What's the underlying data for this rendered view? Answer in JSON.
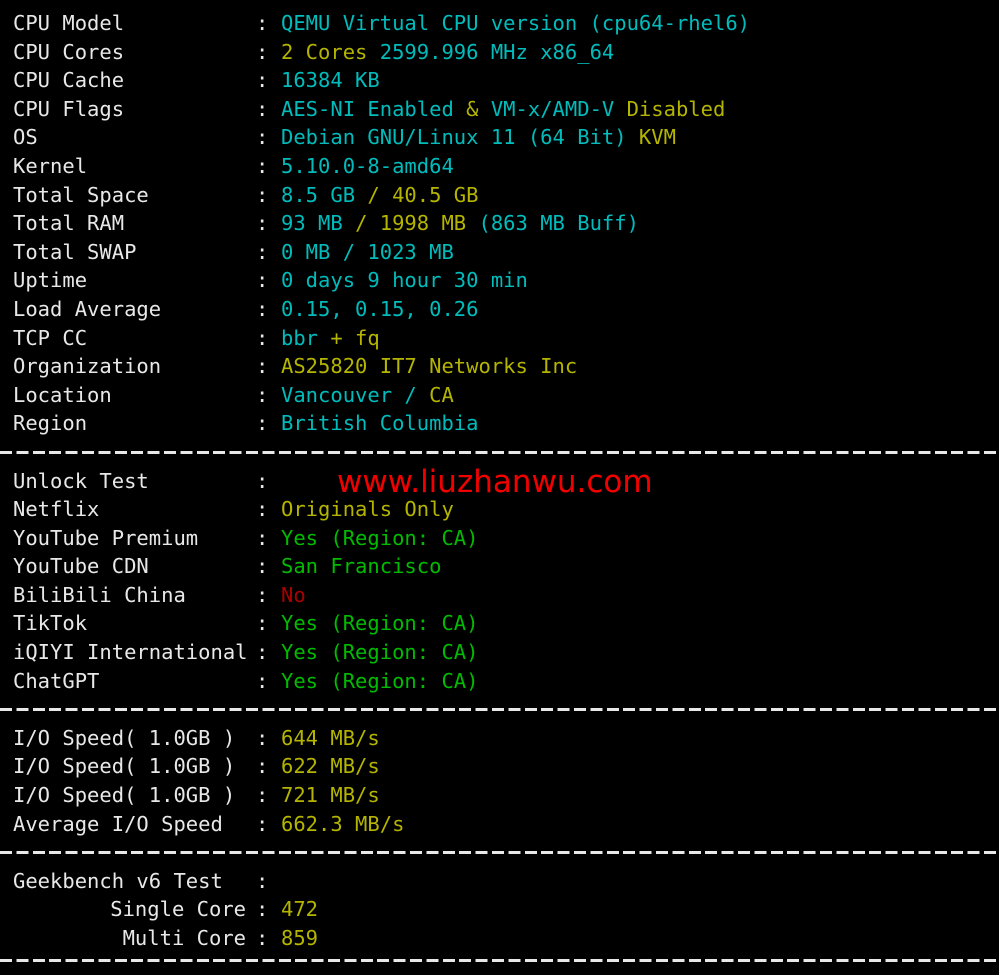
{
  "terminal": {
    "background_color": "#000000",
    "palette": {
      "label": "#e8e8e8",
      "cyan": "#00bcbc",
      "yellow": "#b5b500",
      "green": "#00bb00",
      "red": "#aa0000",
      "watermark_red": "#f20000"
    },
    "colon": ":"
  },
  "watermark": {
    "text": "www.liuzhanwu.com"
  },
  "system_info": [
    {
      "label": "CPU Model",
      "segments": [
        {
          "text": "QEMU Virtual CPU version (cpu64-rhel6)",
          "color": "cyan"
        }
      ]
    },
    {
      "label": "CPU Cores",
      "segments": [
        {
          "text": "2 Cores ",
          "color": "yellow"
        },
        {
          "text": "2599.996 MHz x86_64",
          "color": "cyan"
        }
      ]
    },
    {
      "label": "CPU Cache",
      "segments": [
        {
          "text": "16384 KB",
          "color": "cyan"
        }
      ]
    },
    {
      "label": "CPU Flags",
      "segments": [
        {
          "text": "AES-NI Enabled",
          "color": "cyan"
        },
        {
          "text": " & ",
          "color": "yellow"
        },
        {
          "text": "VM-x/AMD-V",
          "color": "cyan"
        },
        {
          "text": " Disabled",
          "color": "yellow"
        }
      ]
    },
    {
      "label": "OS",
      "segments": [
        {
          "text": "Debian GNU/Linux 11 (64 Bit) ",
          "color": "cyan"
        },
        {
          "text": "KVM",
          "color": "yellow"
        }
      ]
    },
    {
      "label": "Kernel",
      "segments": [
        {
          "text": "5.10.0-8-amd64",
          "color": "cyan"
        }
      ]
    },
    {
      "label": "Total Space",
      "segments": [
        {
          "text": "8.5 GB ",
          "color": "cyan"
        },
        {
          "text": "/ 40.5 GB",
          "color": "yellow"
        }
      ]
    },
    {
      "label": "Total RAM",
      "segments": [
        {
          "text": "93 MB ",
          "color": "cyan"
        },
        {
          "text": "/ 1998 MB ",
          "color": "yellow"
        },
        {
          "text": "(863 MB Buff)",
          "color": "cyan"
        }
      ]
    },
    {
      "label": "Total SWAP",
      "segments": [
        {
          "text": "0 MB / 1023 MB",
          "color": "cyan"
        }
      ]
    },
    {
      "label": "Uptime",
      "segments": [
        {
          "text": "0 days 9 hour 30 min",
          "color": "cyan"
        }
      ]
    },
    {
      "label": "Load Average",
      "segments": [
        {
          "text": "0.15, 0.15, 0.26",
          "color": "cyan"
        }
      ]
    },
    {
      "label": "TCP CC",
      "segments": [
        {
          "text": "bbr ",
          "color": "cyan"
        },
        {
          "text": "+ fq",
          "color": "yellow"
        }
      ]
    },
    {
      "label": "Organization",
      "segments": [
        {
          "text": "AS25820 IT7 Networks Inc",
          "color": "yellow"
        }
      ]
    },
    {
      "label": "Location",
      "segments": [
        {
          "text": "Vancouver / ",
          "color": "cyan"
        },
        {
          "text": "CA",
          "color": "yellow"
        }
      ]
    },
    {
      "label": "Region",
      "segments": [
        {
          "text": "British Columbia",
          "color": "cyan"
        }
      ]
    }
  ],
  "unlock_test": [
    {
      "label": "Unlock Test",
      "segments": []
    },
    {
      "label": "Netflix",
      "segments": [
        {
          "text": "Originals Only",
          "color": "yellow"
        }
      ]
    },
    {
      "label": "YouTube Premium",
      "segments": [
        {
          "text": "Yes (Region: CA)",
          "color": "green"
        }
      ]
    },
    {
      "label": "YouTube CDN",
      "segments": [
        {
          "text": "San Francisco",
          "color": "green"
        }
      ]
    },
    {
      "label": "BiliBili China",
      "segments": [
        {
          "text": "No",
          "color": "red"
        }
      ]
    },
    {
      "label": "TikTok",
      "segments": [
        {
          "text": "Yes (Region: CA)",
          "color": "green"
        }
      ]
    },
    {
      "label": "iQIYI International",
      "segments": [
        {
          "text": "Yes (Region: CA)",
          "color": "green"
        }
      ]
    },
    {
      "label": "ChatGPT",
      "segments": [
        {
          "text": "Yes (Region: CA)",
          "color": "green"
        }
      ]
    }
  ],
  "io_speed": [
    {
      "label": "I/O Speed( 1.0GB )",
      "segments": [
        {
          "text": "644 MB/s",
          "color": "yellow"
        }
      ]
    },
    {
      "label": "I/O Speed( 1.0GB )",
      "segments": [
        {
          "text": "622 MB/s",
          "color": "yellow"
        }
      ]
    },
    {
      "label": "I/O Speed( 1.0GB )",
      "segments": [
        {
          "text": "721 MB/s",
          "color": "yellow"
        }
      ]
    },
    {
      "label": "Average I/O Speed",
      "segments": [
        {
          "text": "662.3 MB/s",
          "color": "yellow"
        }
      ]
    }
  ],
  "geekbench": [
    {
      "label": "Geekbench v6 Test",
      "indent": false,
      "segments": []
    },
    {
      "label": "Single Core",
      "indent": true,
      "segments": [
        {
          "text": "472",
          "color": "yellow"
        }
      ]
    },
    {
      "label": "Multi Core",
      "indent": true,
      "segments": [
        {
          "text": "859",
          "color": "yellow"
        }
      ]
    }
  ]
}
